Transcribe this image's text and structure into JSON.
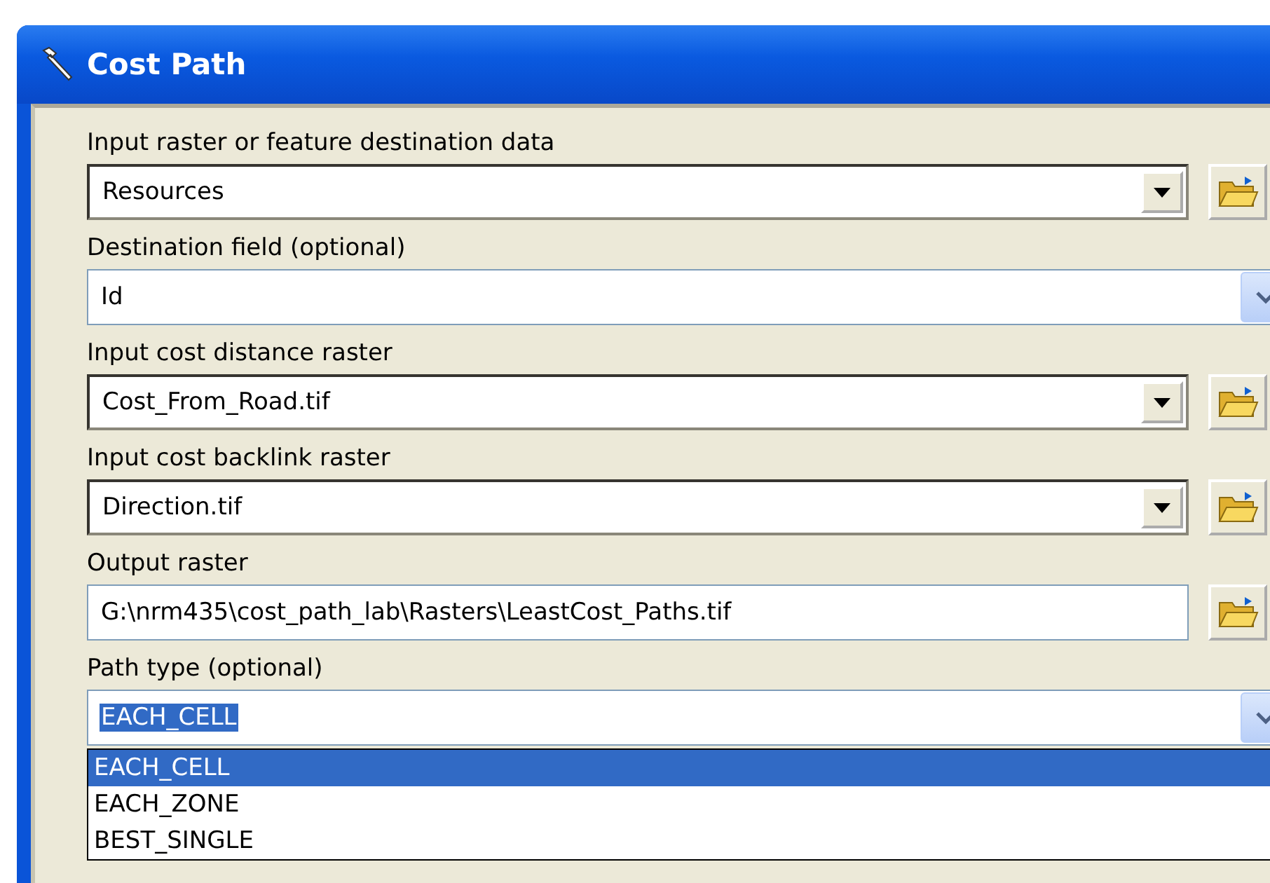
{
  "window": {
    "title": "Cost Path"
  },
  "fields": [
    {
      "label": "Input raster or feature destination data",
      "kind": "combo",
      "value": "Resources"
    },
    {
      "label": "Destination field (optional)",
      "kind": "xpcombo",
      "value": "Id"
    },
    {
      "label": "Input cost distance raster",
      "kind": "combo",
      "value": "Cost_From_Road.tif"
    },
    {
      "label": "Input cost backlink raster",
      "kind": "combo",
      "value": "Direction.tif"
    },
    {
      "label": "Output raster",
      "kind": "text",
      "value": "G:\\nrm435\\cost_path_lab\\Rasters\\LeastCost_Paths.tif"
    },
    {
      "label": "Path type (optional)",
      "kind": "xpcombo",
      "value": "EACH_CELL",
      "value_selected": true,
      "open": true,
      "options": [
        {
          "label": "EACH_CELL",
          "selected": true
        },
        {
          "label": "EACH_ZONE",
          "selected": false
        },
        {
          "label": "BEST_SINGLE",
          "selected": false
        }
      ]
    }
  ]
}
